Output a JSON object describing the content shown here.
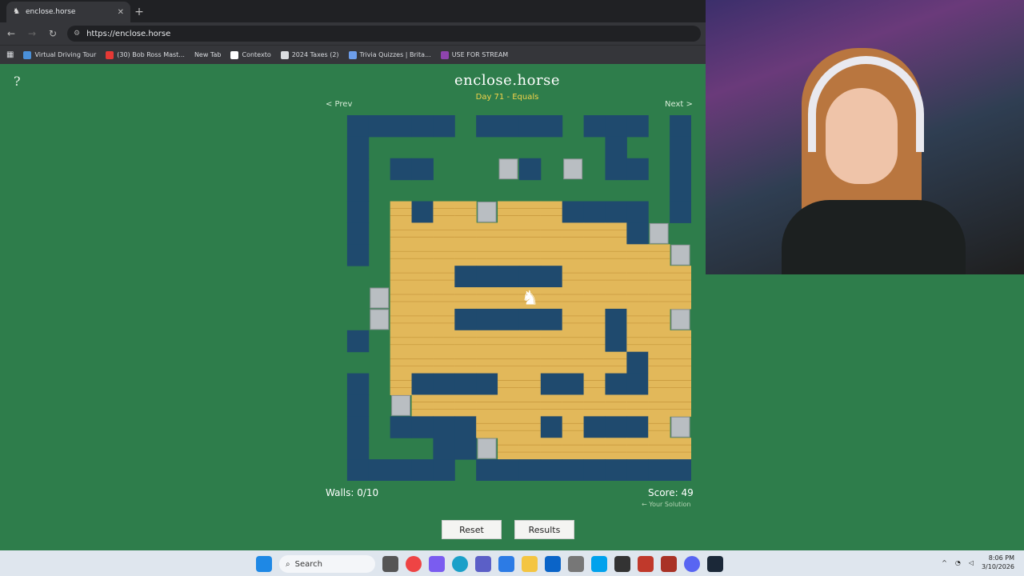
{
  "browser": {
    "tab_title": "enclose.horse",
    "url": "https://enclose.horse",
    "bookmarks": [
      {
        "label": "Virtual Driving Tour",
        "icon": "globe-icon",
        "color": "#4a90d9"
      },
      {
        "label": "(30) Bob Ross Mast...",
        "icon": "youtube-icon",
        "color": "#e53935"
      },
      {
        "label": "New Tab",
        "icon": "",
        "color": ""
      },
      {
        "label": "Contexto",
        "icon": "contexto-icon",
        "color": "#ffffff"
      },
      {
        "label": "2024 Taxes (2)",
        "icon": "folder-icon",
        "color": "#dadce0"
      },
      {
        "label": "Trivia Quizzes | Brita...",
        "icon": "britannica-icon",
        "color": "#6d9eeb"
      },
      {
        "label": "USE FOR STREAM",
        "icon": "p-icon",
        "color": "#8e44ad"
      }
    ]
  },
  "game": {
    "help_label": "?",
    "title": "enclose.horse",
    "subtitle": "Day 71 - Equals",
    "prev_label": "< Prev",
    "next_label": "Next >",
    "walls_text": "Walls: 0/10",
    "score_text": "Score: 49",
    "your_solution": "← Your Solution",
    "reset_label": "Reset",
    "results_label": "Results",
    "colors": {
      "grass": "#2e7d4b",
      "water": "#1f4a6e",
      "hay": "#e2b85a",
      "wall": "#b9bec2",
      "title_accent": "#f3d34a"
    },
    "grid_size": 17,
    "map_rows": [
      ".WWWWW.WWWW.WWW.WW",
      ".W...........W..W.",
      ".W.WW...BW.B.WW.W.",
      ".W..............W.",
      ".W.CWHHBHHCWWWW.W.",
      ".W.CHHHHHHHHHHWB.W",
      ".W.CHHHHHHHHHHHHB.",
      "...CHHWWWWWHHHHHH.",
      "..BHHHHHHAHHHHHHH.",
      "..BHHHWWWWWHHWHHB.",
      ".W.HHHHHHHHHHWHHH.",
      "...CHHHHHHHHHHWHH.",
      ".W.CWWWWHHWWHWWHH.",
      ".W.BHHHHHHHHHHHHH.",
      ".W.WWWWHHHWHWWWHB.",
      ".W...WWBHHHHHHHHH.",
      ".WWWWW.WWWWWWWWWW."
    ],
    "legend": {
      ".": "grass",
      "W": "water",
      "H": "hay",
      "B": "wall",
      "C": "hay-edge",
      "A": "horse"
    }
  },
  "taskbar": {
    "search_label": "Search",
    "time": "8:06 PM",
    "date": "3/10/2026"
  }
}
